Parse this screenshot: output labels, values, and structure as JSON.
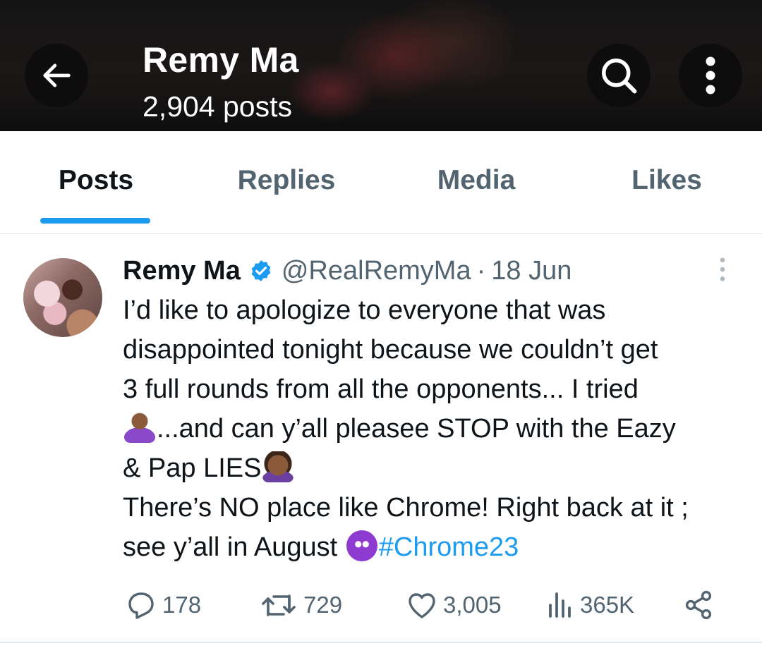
{
  "header": {
    "title": "Remy Ma",
    "subtitle": "2,904 posts",
    "back_icon": "arrow-left-icon",
    "search_icon": "search-icon",
    "more_icon": "more-vertical-icon"
  },
  "tabs": [
    {
      "label": "Posts",
      "active": true
    },
    {
      "label": "Replies",
      "active": false
    },
    {
      "label": "Media",
      "active": false
    },
    {
      "label": "Likes",
      "active": false
    }
  ],
  "post": {
    "author": "Remy Ma",
    "verified": true,
    "handle": "@RealRemyMa",
    "separator": "·",
    "date": "18 Jun",
    "text_lines": [
      "I’d like to apologize to everyone that was",
      "disappointed tonight because we couldn’t get",
      "3 full rounds from all the opponents... I tried",
      "...and can y’all pleasee STOP with the Eazy",
      "& Pap LIES",
      "There’s NO place like Chrome! Right back at it ;",
      "see y’all in August "
    ],
    "hashtag": "#Chrome23",
    "stats": {
      "replies": "178",
      "reposts": "729",
      "likes": "3,005",
      "views": "365K"
    }
  },
  "colors": {
    "accent": "#1d9bf0",
    "text_primary": "#0f1419",
    "text_secondary": "#536471",
    "divider": "#e1e8ed"
  }
}
